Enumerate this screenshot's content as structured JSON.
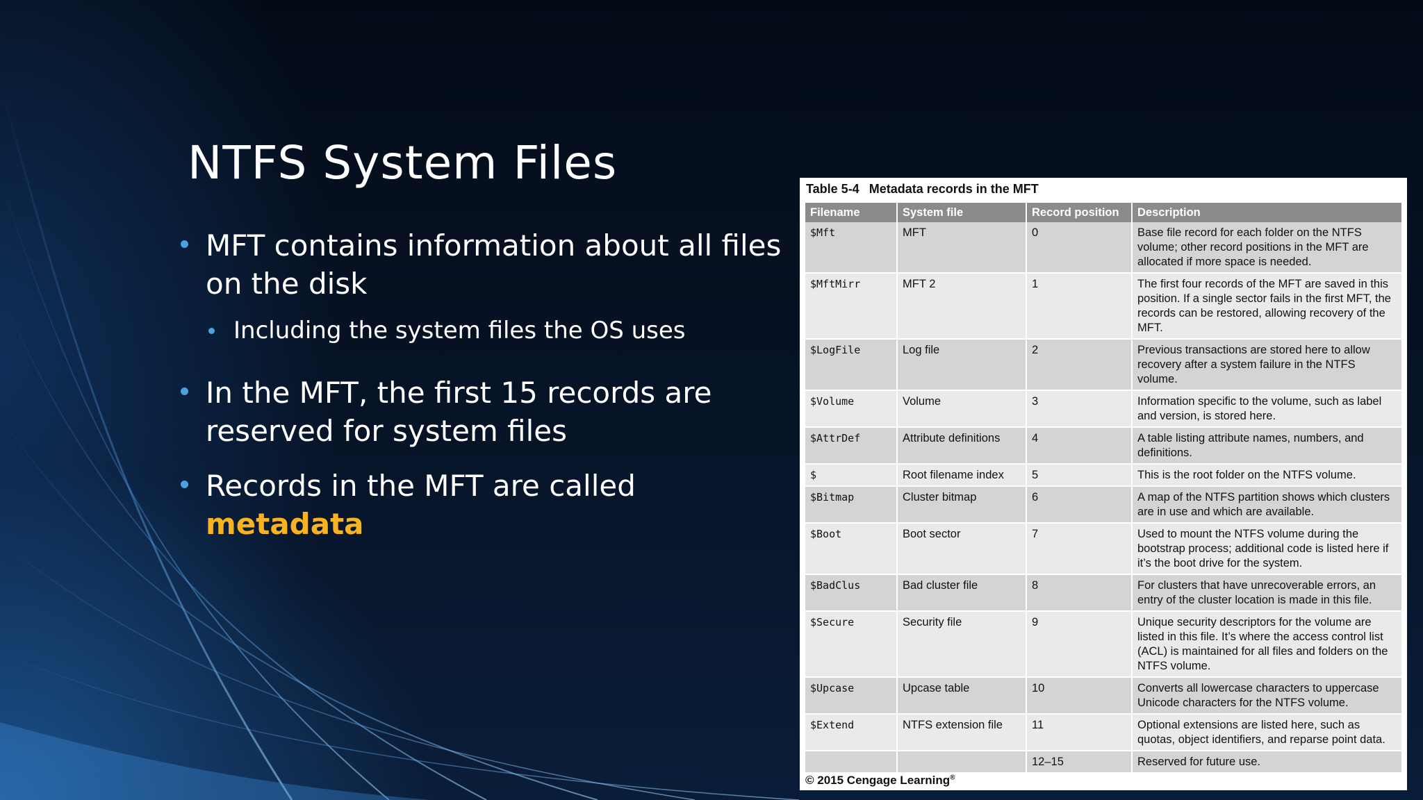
{
  "slide": {
    "title": "NTFS System Files",
    "bullets": [
      {
        "text": "MFT contains information about all files  on the disk"
      },
      {
        "text": "Including the system files the OS uses"
      },
      {
        "text": "In the MFT, the first 15 records are reserved for system files"
      },
      {
        "text_before": "Records in the MFT are called ",
        "highlight": "metadata"
      }
    ],
    "highlight_color": "#f7b322",
    "bullet_color": "#4aa3df"
  },
  "table_figure": {
    "caption_number": "Table 5-4",
    "caption_title": "Metadata records in the MFT",
    "columns": [
      "Filename",
      "System file",
      "Record position",
      "Description"
    ],
    "rows": [
      [
        "$Mft",
        "MFT",
        "0",
        "Base file record for each folder on the NTFS volume; other record positions in the MFT are allocated if more space is needed."
      ],
      [
        "$MftMirr",
        "MFT 2",
        "1",
        "The first four records of the MFT are saved in this position. If a single sector fails in the first MFT, the records can be restored, allowing recovery of the MFT."
      ],
      [
        "$LogFile",
        "Log file",
        "2",
        "Previous transactions are stored here to allow recovery after a system failure in the NTFS volume."
      ],
      [
        "$Volume",
        "Volume",
        "3",
        "Information specific to the volume, such as label and version, is stored here."
      ],
      [
        "$AttrDef",
        "Attribute definitions",
        "4",
        "A table listing attribute names, numbers, and definitions."
      ],
      [
        "$",
        "Root filename index",
        "5",
        "This is the root folder on the NTFS volume."
      ],
      [
        "$Bitmap",
        "Cluster bitmap",
        "6",
        "A map of the NTFS partition shows which clusters are in use and which are available."
      ],
      [
        "$Boot",
        "Boot sector",
        "7",
        "Used to mount the NTFS volume during the bootstrap process; additional code is listed here if it’s the boot drive for the system."
      ],
      [
        "$BadClus",
        "Bad cluster file",
        "8",
        "For clusters that have unrecoverable errors, an entry of the cluster location is made in this file."
      ],
      [
        "$Secure",
        "Security file",
        "9",
        "Unique security descriptors for the volume are listed in this file. It’s where the access control list (ACL) is maintained for all files and folders on the NTFS volume."
      ],
      [
        "$Upcase",
        "Upcase table",
        "10",
        "Converts all lowercase characters to uppercase Unicode characters for the NTFS volume."
      ],
      [
        "$Extend",
        "NTFS extension file",
        "11",
        "Optional extensions are listed here, such as quotas, object identifiers, and reparse point data."
      ],
      [
        "",
        "",
        "12–15",
        "Reserved for future use."
      ]
    ],
    "copyright": "© 2015 Cengage Learning",
    "copyright_mark": "®"
  }
}
